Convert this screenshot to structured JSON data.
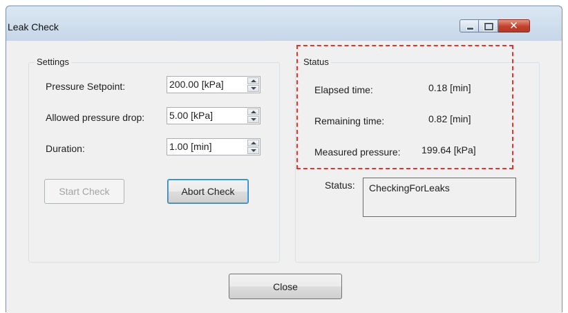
{
  "window": {
    "title": "Leak Check",
    "close_glyph": "✕"
  },
  "settings": {
    "legend": "Settings",
    "pressure_setpoint": {
      "label": "Pressure Setpoint:",
      "value": "200.00 [kPa]"
    },
    "allowed_drop": {
      "label": "Allowed pressure drop:",
      "value": "5.00 [kPa]"
    },
    "duration": {
      "label": "Duration:",
      "value": "1.00 [min]"
    },
    "start_button": "Start Check",
    "abort_button": "Abort Check"
  },
  "status": {
    "legend": "Status",
    "elapsed": {
      "label": "Elapsed time:",
      "value": "0.18 [min]"
    },
    "remaining": {
      "label": "Remaining time:",
      "value": "0.82 [min]"
    },
    "measured": {
      "label": "Measured pressure:",
      "value": "199.64 [kPa]"
    },
    "status_label": "Status:",
    "status_value": "CheckingForLeaks"
  },
  "footer": {
    "close_button": "Close"
  },
  "colors": {
    "highlight": "#e8332c",
    "focus": "#3c7fb1"
  },
  "icons": [
    "minimize-icon",
    "maximize-icon",
    "close-icon",
    "spin-up-icon",
    "spin-down-icon"
  ]
}
